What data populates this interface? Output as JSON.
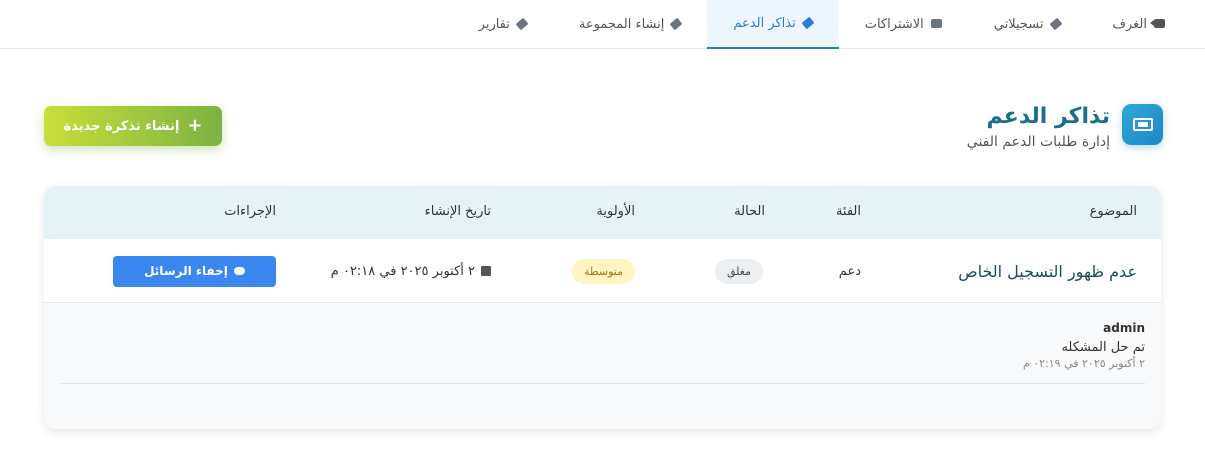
{
  "nav": {
    "tabs": [
      {
        "label": "الغرف",
        "icon": "camera-icon",
        "active": false
      },
      {
        "label": "تسجيلاتي",
        "icon": "tag-icon",
        "active": false
      },
      {
        "label": "الاشتراكات",
        "icon": "tv-icon",
        "active": false
      },
      {
        "label": "تذاكر الدعم",
        "icon": "tag-icon",
        "active": true
      },
      {
        "label": "إنشاء المجموعة",
        "icon": "tag-icon",
        "active": false
      },
      {
        "label": "تقارير",
        "icon": "tag-icon",
        "active": false
      }
    ]
  },
  "header": {
    "title": "تذاكر الدعم",
    "subtitle": "إدارة طلبات الدعم الفني",
    "icon": "ticket-icon"
  },
  "new_ticket_button": {
    "label": "إنشاء تذكرة جديدة",
    "icon": "plus-icon"
  },
  "table": {
    "columns": {
      "subject": "الموضوع",
      "category": "الفئة",
      "status": "الحالة",
      "priority": "الأولوية",
      "created": "تاريخ الإنشاء",
      "actions": "الإجراءات"
    },
    "rows": [
      {
        "subject": "عدم ظهور التسجيل الخاص",
        "category": "دعم",
        "status": "مغلق",
        "priority": "متوسطة",
        "created": "٢ أكتوبر ٢٠٢٥ في ٠٢:١٨ م",
        "action_label": "إخفاء الرسائل"
      }
    ]
  },
  "messages": [
    {
      "author": "admin",
      "text": "تم حل المشكله",
      "date": "٢ أكتوبر ٢٠٢٥ في ٠٢:١٩ م"
    }
  ],
  "colors": {
    "accent": "#2b7bd4",
    "title": "#1a6f8a",
    "button_green_start": "#c9de3a",
    "button_green_end": "#7cb342",
    "table_header_bg": "#e6f3f6",
    "priority_badge_bg": "#fff4c2",
    "action_button_bg": "#3a87f0"
  }
}
